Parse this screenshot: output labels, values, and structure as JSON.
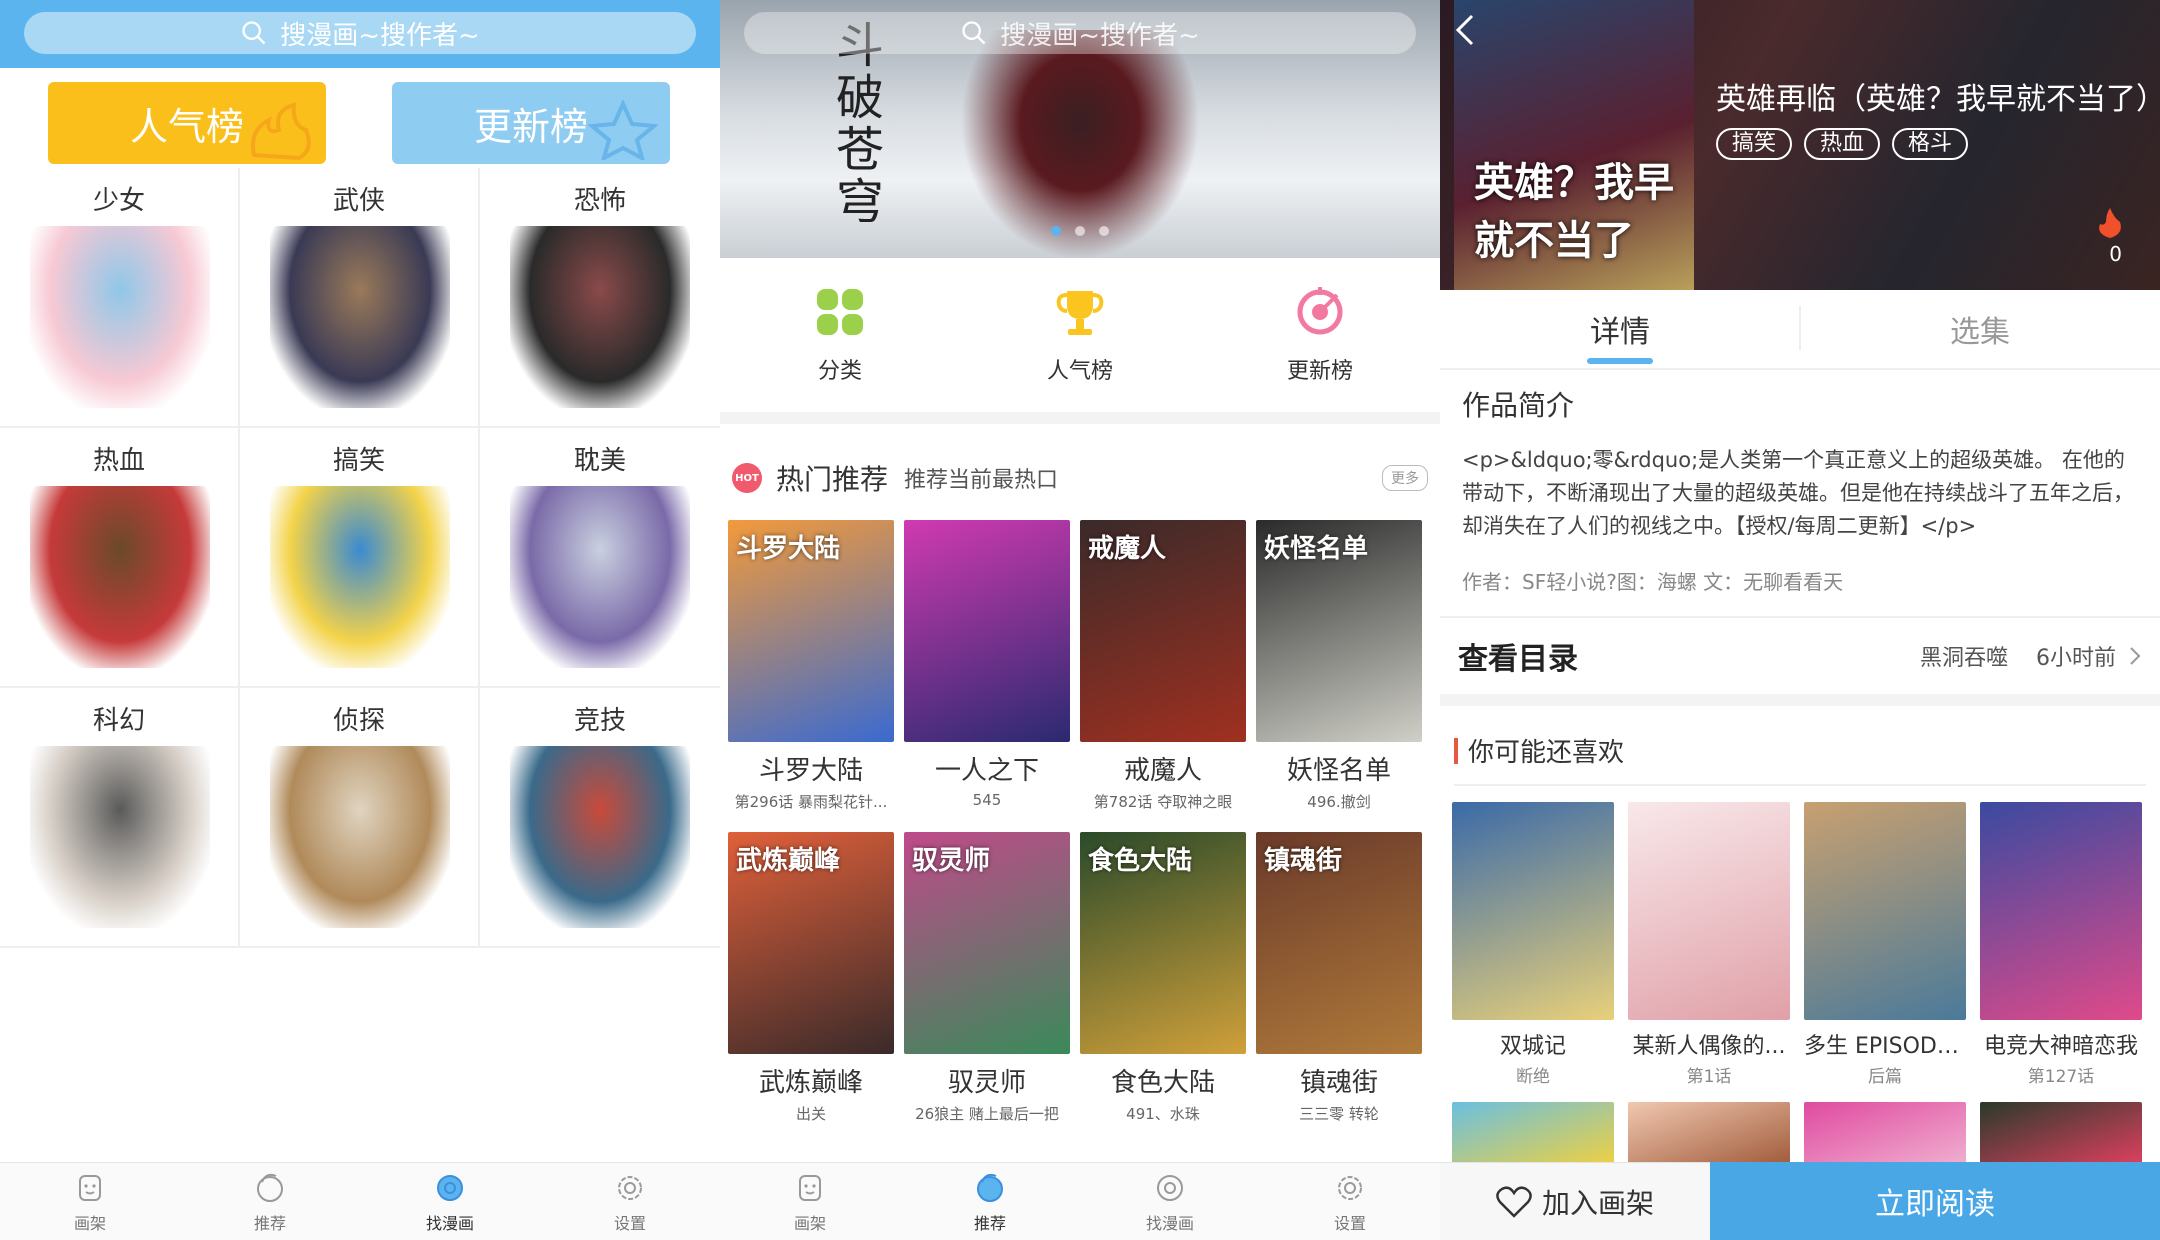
{
  "colors": {
    "accent": "#5bb4ee",
    "popular": "#fbbf1b",
    "update": "#8fccf1",
    "read_button": "#4aa7e6",
    "hot_badge": "#f15a6d"
  },
  "screen1": {
    "search_placeholder": "搜漫画~搜作者~",
    "popular_label": "人气榜",
    "update_label": "更新榜",
    "genres": [
      {
        "label": "少女",
        "icon": "girl-art",
        "c1": "#f7c9d4",
        "c2": "#8fc7e8"
      },
      {
        "label": "武侠",
        "icon": "swordsman-art",
        "c1": "#3a3a55",
        "c2": "#9a7a5a"
      },
      {
        "label": "恐怖",
        "icon": "ghost-art",
        "c1": "#2a2a2a",
        "c2": "#8a4a4a"
      },
      {
        "label": "热血",
        "icon": "hotblood-art",
        "c1": "#c63a3a",
        "c2": "#6a4a2a"
      },
      {
        "label": "搞笑",
        "icon": "funny-art",
        "c1": "#f3d34a",
        "c2": "#3a8ad0"
      },
      {
        "label": "耽美",
        "icon": "bl-art",
        "c1": "#7a6aa8",
        "c2": "#c9d0e0"
      },
      {
        "label": "科幻",
        "icon": "astronaut-art",
        "c1": "#d8d0c8",
        "c2": "#5a5a5a"
      },
      {
        "label": "侦探",
        "icon": "detective-art",
        "c1": "#b08a5a",
        "c2": "#e0d4c0"
      },
      {
        "label": "竞技",
        "icon": "sports-art",
        "c1": "#3a6a8a",
        "c2": "#c94a3a"
      }
    ],
    "nav": [
      {
        "label": "画架",
        "icon": "shelf-icon",
        "active": false
      },
      {
        "label": "推荐",
        "icon": "recommend-icon",
        "active": false
      },
      {
        "label": "找漫画",
        "icon": "find-icon",
        "active": true
      },
      {
        "label": "设置",
        "icon": "settings-icon",
        "active": false
      }
    ]
  },
  "screen2": {
    "search_placeholder": "搜漫画~搜作者~",
    "banner_calligraphy": "斗破苍穹",
    "quick": [
      {
        "label": "分类",
        "icon": "category-icon"
      },
      {
        "label": "人气榜",
        "icon": "trophy-icon"
      },
      {
        "label": "更新榜",
        "icon": "target-icon"
      }
    ],
    "hot_badge": "HOT",
    "hot_title": "热门推荐",
    "hot_sub": "推荐当前最热口",
    "more": "更多",
    "comics": [
      {
        "cover_text": "斗罗大陆",
        "name": "斗罗大陆",
        "sub": "第296话 暴雨梨花针...",
        "c1": "#f39a3a",
        "c2": "#3a6ad0"
      },
      {
        "cover_text": "",
        "name": "一人之下",
        "sub": "545",
        "c1": "#d03ab0",
        "c2": "#2a2a70"
      },
      {
        "cover_text": "戒魔人",
        "name": "戒魔人",
        "sub": "第782话 夺取神之眼",
        "c1": "#3a2a2a",
        "c2": "#a03020"
      },
      {
        "cover_text": "妖怪名单",
        "name": "妖怪名单",
        "sub": "496.撤剑",
        "c1": "#2a2a2a",
        "c2": "#d0d0c8"
      },
      {
        "cover_text": "武炼巅峰",
        "name": "武炼巅峰",
        "sub": "出关",
        "c1": "#e0603a",
        "c2": "#3a2a2a"
      },
      {
        "cover_text": "驭灵师",
        "name": "驭灵师",
        "sub": "26狼主 赌上最后一把",
        "c1": "#c04a8a",
        "c2": "#3a8a5a"
      },
      {
        "cover_text": "食色大陆",
        "name": "食色大陆",
        "sub": "491、水珠",
        "c1": "#2a4a2a",
        "c2": "#d0a03a"
      },
      {
        "cover_text": "镇魂街",
        "name": "镇魂街",
        "sub": "三三零 转轮",
        "c1": "#6a3a2a",
        "c2": "#b07a3a"
      }
    ],
    "nav": [
      {
        "label": "画架",
        "icon": "shelf-icon",
        "active": false
      },
      {
        "label": "推荐",
        "icon": "recommend-icon",
        "active": true
      },
      {
        "label": "找漫画",
        "icon": "find-icon",
        "active": false
      },
      {
        "label": "设置",
        "icon": "settings-icon",
        "active": false
      }
    ]
  },
  "screen3": {
    "title": "英雄再临（英雄？我早就不当了）",
    "cover_text": "英雄？我早就不当了",
    "tags": [
      "搞笑",
      "热血",
      "格斗"
    ],
    "fire_count": "0",
    "tabs": [
      {
        "label": "详情",
        "active": true
      },
      {
        "label": "选集",
        "active": false
      }
    ],
    "intro_heading": "作品简介",
    "intro_text": "<p>&ldquo;零&rdquo;是人类第一个真正意义上的超级英雄。 在他的带动下，不断涌现出了大量的超级英雄。但是他在持续战斗了五年之后，却消失在了人们的视线之中。【授权/每周二更新】</p>",
    "author": "作者：SF轻小说?图：海螺 文：无聊看看天",
    "toc_title": "查看目录",
    "toc_latest": "黑洞吞噬",
    "toc_time": "6小时前",
    "like_heading": "你可能还喜欢",
    "likes": [
      {
        "name": "双城记",
        "sub": "断绝",
        "c1": "#3a6aa8",
        "c2": "#e8d07a"
      },
      {
        "name": "某新人偶像的...",
        "sub": "第1话",
        "c1": "#f8e8ea",
        "c2": "#e0a0a8"
      },
      {
        "name": "多生 EPISODE ...",
        "sub": "后篇",
        "c1": "#c8a070",
        "c2": "#4a7a9a"
      },
      {
        "name": "电竞大神暗恋我",
        "sub": "第127话",
        "c1": "#3a4aa0",
        "c2": "#e04a8a"
      }
    ],
    "likes_row2": [
      {
        "c1": "#6ac0e0",
        "c2": "#f0d040"
      },
      {
        "c1": "#f0c8b0",
        "c2": "#a05a3a"
      },
      {
        "c1": "#e04aa0",
        "c2": "#f0b0d0"
      },
      {
        "c1": "#2a3a2a",
        "c2": "#e04060"
      }
    ],
    "add_shelf": "加入画架",
    "read_now": "立即阅读"
  }
}
